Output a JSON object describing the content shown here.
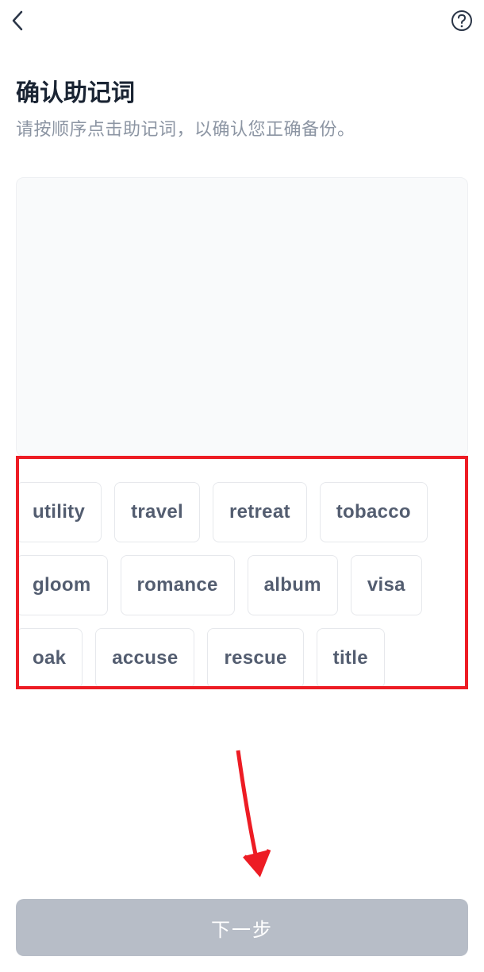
{
  "header": {
    "title": "确认助记词",
    "subtitle": "请按顺序点击助记词，以确认您正确备份。"
  },
  "mnemonic_words": [
    "utility",
    "travel",
    "retreat",
    "tobacco",
    "gloom",
    "romance",
    "album",
    "visa",
    "oak",
    "accuse",
    "rescue",
    "title"
  ],
  "footer": {
    "next_label": "下一步"
  },
  "annotations": {
    "highlight_color": "#ed1c24",
    "arrow_color": "#ed1c24"
  }
}
